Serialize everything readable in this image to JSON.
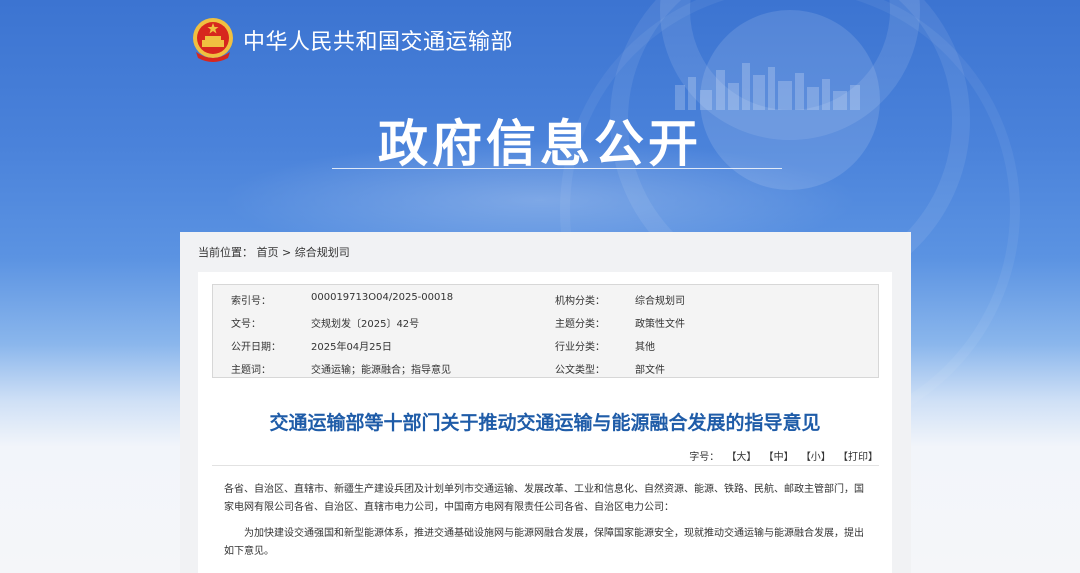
{
  "header": {
    "site_name": "中华人民共和国交通运输部",
    "banner_title": "政府信息公开"
  },
  "breadcrumb": {
    "label": "当前位置：",
    "home": "首页",
    "separator": ">",
    "current": "综合规划司"
  },
  "meta": {
    "rows": [
      {
        "k1": "索引号：",
        "v1": "000019713O04/2025-00018",
        "k2": "机构分类：",
        "v2": "综合规划司"
      },
      {
        "k1": "文号：",
        "v1": "交规划发〔2025〕42号",
        "k2": "主题分类：",
        "v2": "政策性文件"
      },
      {
        "k1": "公开日期：",
        "v1": "2025年04月25日",
        "k2": "行业分类：",
        "v2": "其他"
      },
      {
        "k1": "主题词：",
        "v1": "交通运输；能源融合；指导意见",
        "k2": "公文类型：",
        "v2": "部文件"
      }
    ]
  },
  "document": {
    "title": "交通运输部等十部门关于推动交通运输与能源融合发展的指导意见",
    "font_label": "字号：",
    "font_large": "【大】",
    "font_medium": "【中】",
    "font_small": "【小】",
    "print": "【打印】",
    "para1": "各省、自治区、直辖市、新疆生产建设兵团及计划单列市交通运输、发展改革、工业和信息化、自然资源、能源、铁路、民航、邮政主管部门，国家电网有限公司各省、自治区、直辖市电力公司，中国南方电网有限责任公司各省、自治区电力公司：",
    "para2": "为加快建设交通强国和新型能源体系，推进交通基础设施网与能源网融合发展，保障国家能源安全，现就推动交通运输与能源融合发展，提出如下意见。"
  },
  "colors": {
    "banner_blue": "#3c74d1",
    "title_blue": "#1f5ca8"
  }
}
